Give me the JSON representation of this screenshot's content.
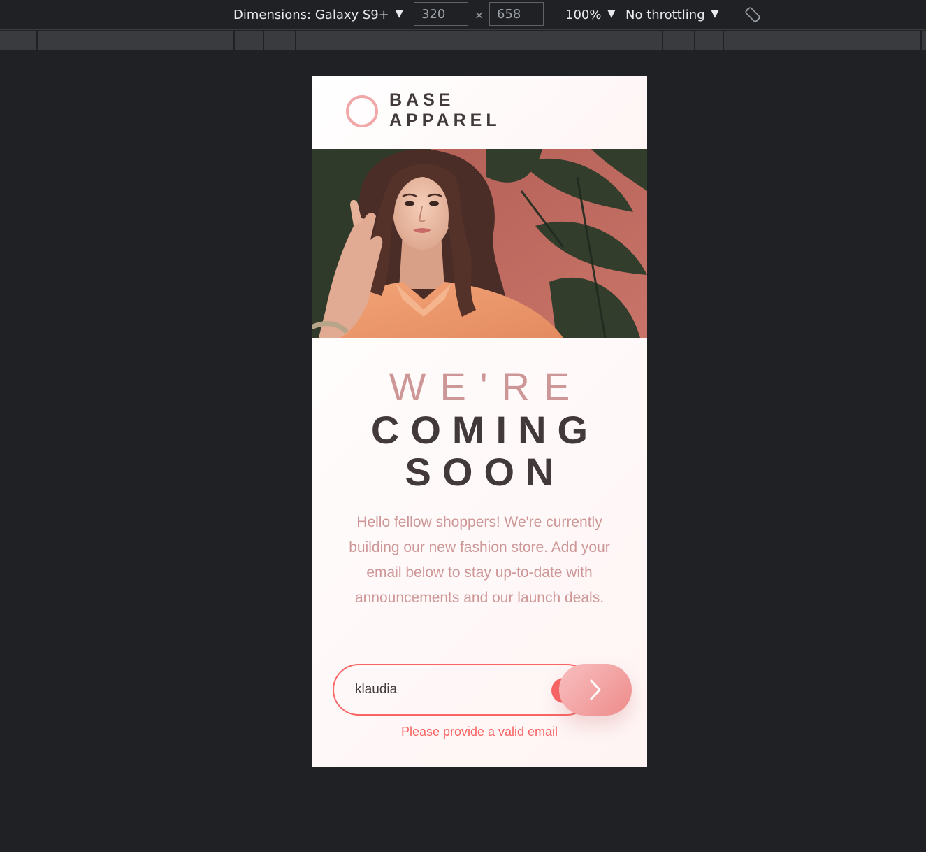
{
  "devtools": {
    "dimensions_label": "Dimensions: Galaxy S9+",
    "width_value": "320",
    "height_value": "658",
    "times_symbol": "×",
    "zoom_label": "100%",
    "throttling_label": "No throttling",
    "caret": "▼",
    "rotate_icon": "rotate-device-icon"
  },
  "page": {
    "brand_line1": "BASE",
    "brand_line2": "APPAREL",
    "logo_icon": "ring-logo-icon",
    "headline_light": "WE'RE",
    "headline_bold_line1": "COMING",
    "headline_bold_line2": "SOON",
    "description": "Hello fellow shoppers! We're currently building our new fashion store. Add your email below to stay up-to-date with announcements and our launch deals.",
    "email_value": "klaudia",
    "error_icon_glyph": "!",
    "error_message": "Please provide a valid email",
    "submit_icon": "chevron-right-icon"
  },
  "colors": {
    "accent": "#f96464",
    "pink_text": "#ce9797",
    "dark_text": "#423a3a",
    "gradient_from": "#f8bfbf",
    "gradient_to": "#ee8b8b",
    "devtools_bg": "#202124"
  }
}
